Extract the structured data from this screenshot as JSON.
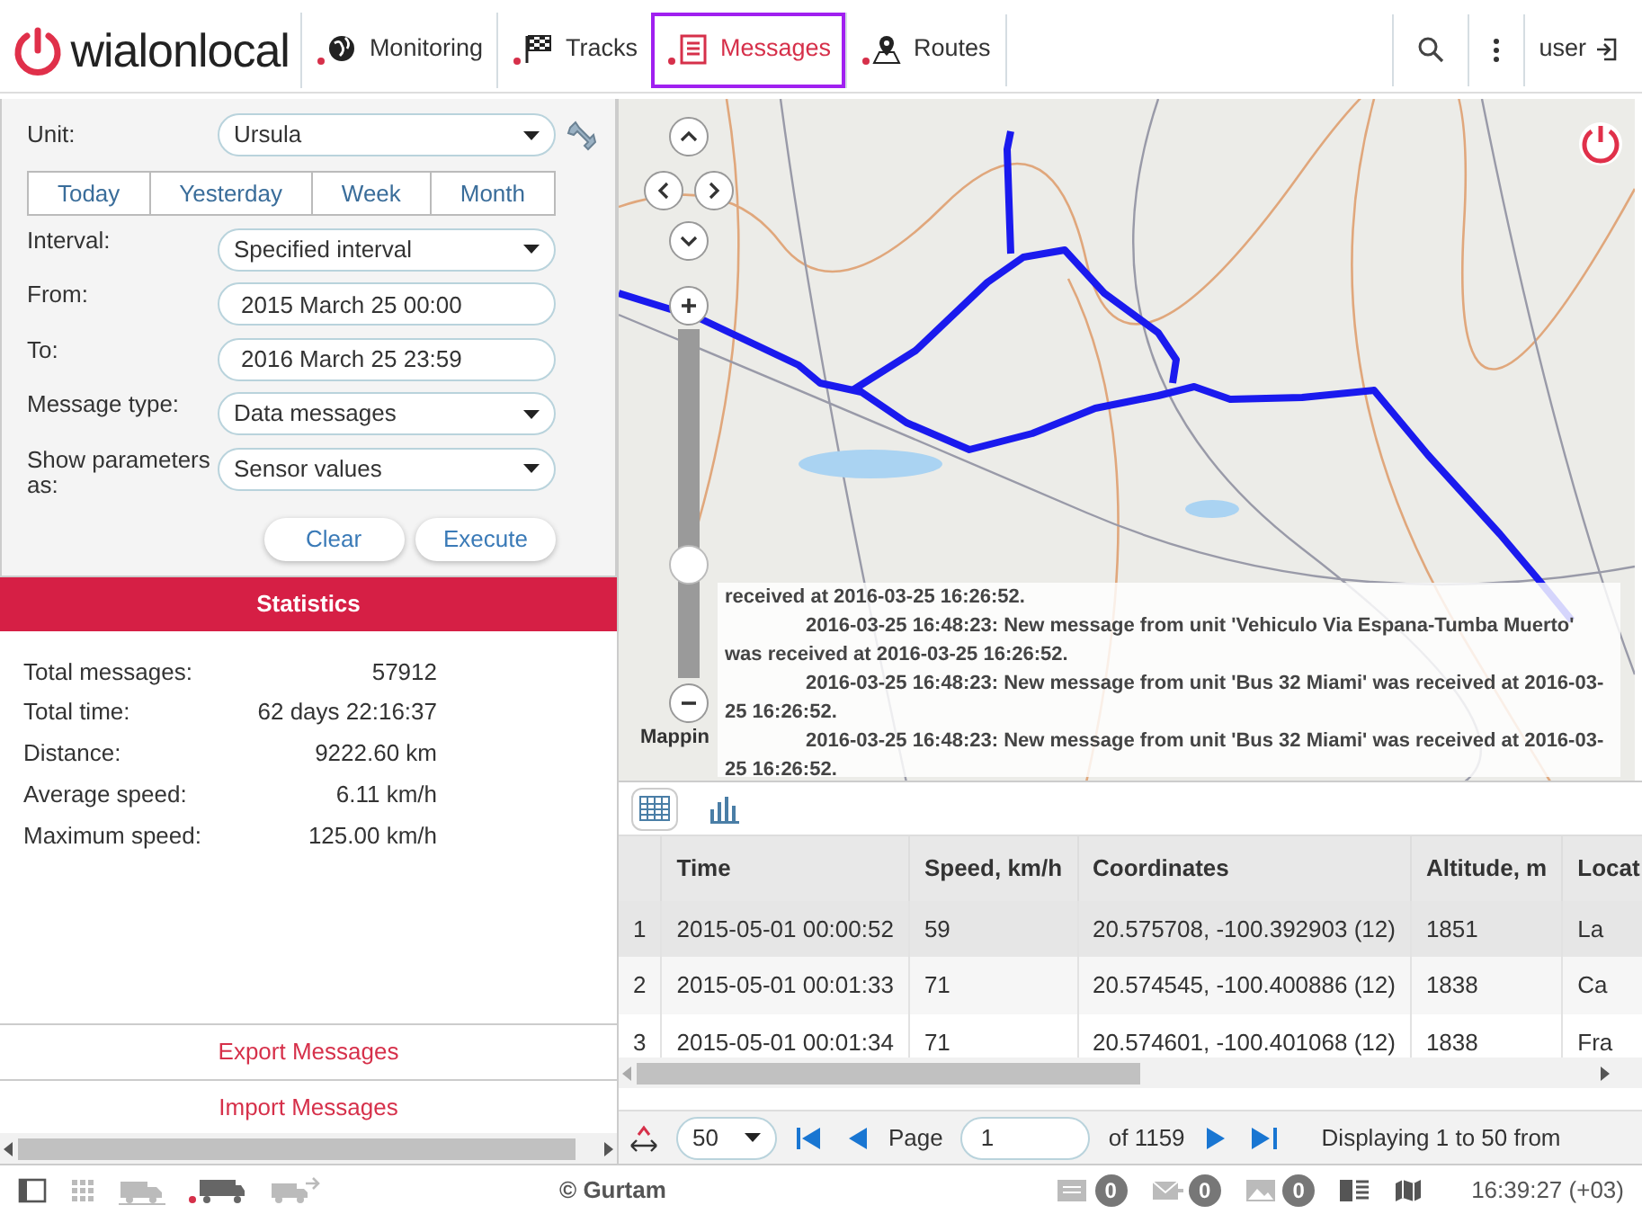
{
  "top_bar": {
    "logo_text": "wialonlocal",
    "nav": [
      {
        "label": "Monitoring",
        "selected": false
      },
      {
        "label": "Tracks",
        "selected": false
      },
      {
        "label": "Messages",
        "selected": true
      },
      {
        "label": "Routes",
        "selected": false
      }
    ],
    "user": "user"
  },
  "filters": {
    "unit": {
      "label": "Unit:",
      "value": "Ursula"
    },
    "periods": [
      {
        "label": "Today",
        "selected": false
      },
      {
        "label": "Yesterday",
        "selected": false
      },
      {
        "label": "Week",
        "selected": false
      },
      {
        "label": "Month",
        "selected": false
      }
    ],
    "fields": [
      {
        "label": "Interval:",
        "kind": "select",
        "value": "Specified interval"
      },
      {
        "label": "From:",
        "kind": "input",
        "value": "2015 March 25 00:00"
      },
      {
        "label": "To:",
        "kind": "input",
        "value": "2016 March 25 23:59"
      },
      {
        "label": "Message type:",
        "kind": "select",
        "value": "Data messages"
      },
      {
        "label": "Show parameters as:",
        "kind": "select",
        "value": "Sensor values"
      }
    ],
    "buttons": [
      "Clear",
      "Execute"
    ]
  },
  "statistics": {
    "title": "Statistics",
    "rows": [
      {
        "label": "Total messages:",
        "value": "57912"
      },
      {
        "label": "Total time:",
        "value": "62 days 22:16:37"
      },
      {
        "label": "Distance:",
        "value": "9222.60 km"
      },
      {
        "label": "Average speed:",
        "value": "6.11 km/h"
      },
      {
        "label": "Maximum speed:",
        "value": "125.00 km/h"
      }
    ]
  },
  "actions": [
    "Export Messages",
    "Import Messages"
  ],
  "map": {
    "zoom_slider": {
      "level": 0.3
    },
    "attribution": "Mappin",
    "notifications": [
      "received at 2016-03-25 16:26:52.",
      "2016-03-25 16:48:23: New message from unit 'Vehiculo Via Espana-Tumba Muerto' was received at 2016-03-25 16:26:52.",
      "2016-03-25 16:48:23: New message from unit 'Bus 32 Miami' was received at 2016-03-25 16:26:52.",
      "2016-03-25 16:48:23: New message from unit 'Bus 32 Miami' was received at 2016-03-25 16:26:52."
    ]
  },
  "view_buttons": [
    {
      "selected": true
    },
    {
      "selected": false
    }
  ],
  "table": {
    "columns": [
      "Time",
      "Speed, km/h",
      "Coordinates",
      "Altitude, m",
      "Locat"
    ],
    "rows": [
      {
        "index": "1",
        "cells": [
          "2015-05-01 00:00:52",
          "59",
          "20.575708, -100.392903 (12)",
          "1851",
          "La"
        ],
        "selected": true
      },
      {
        "index": "2",
        "cells": [
          "2015-05-01 00:01:33",
          "71",
          "20.574545, -100.400886 (12)",
          "1838",
          "Ca"
        ],
        "selected": false
      },
      {
        "index": "3",
        "cells": [
          "2015-05-01 00:01:34",
          "71",
          "20.574601, -100.401068 (12)",
          "1838",
          "Fra"
        ],
        "selected": false
      }
    ]
  },
  "pager": {
    "page_size": "50",
    "page_label": "Page",
    "page": "1",
    "page_count": "of 1159",
    "summary": "Displaying 1 to 50 from"
  },
  "status_bar": {
    "copyright": "© Gurtam",
    "counters": [
      "0",
      "0",
      "0"
    ],
    "clock": "16:39:27 (+03)"
  }
}
